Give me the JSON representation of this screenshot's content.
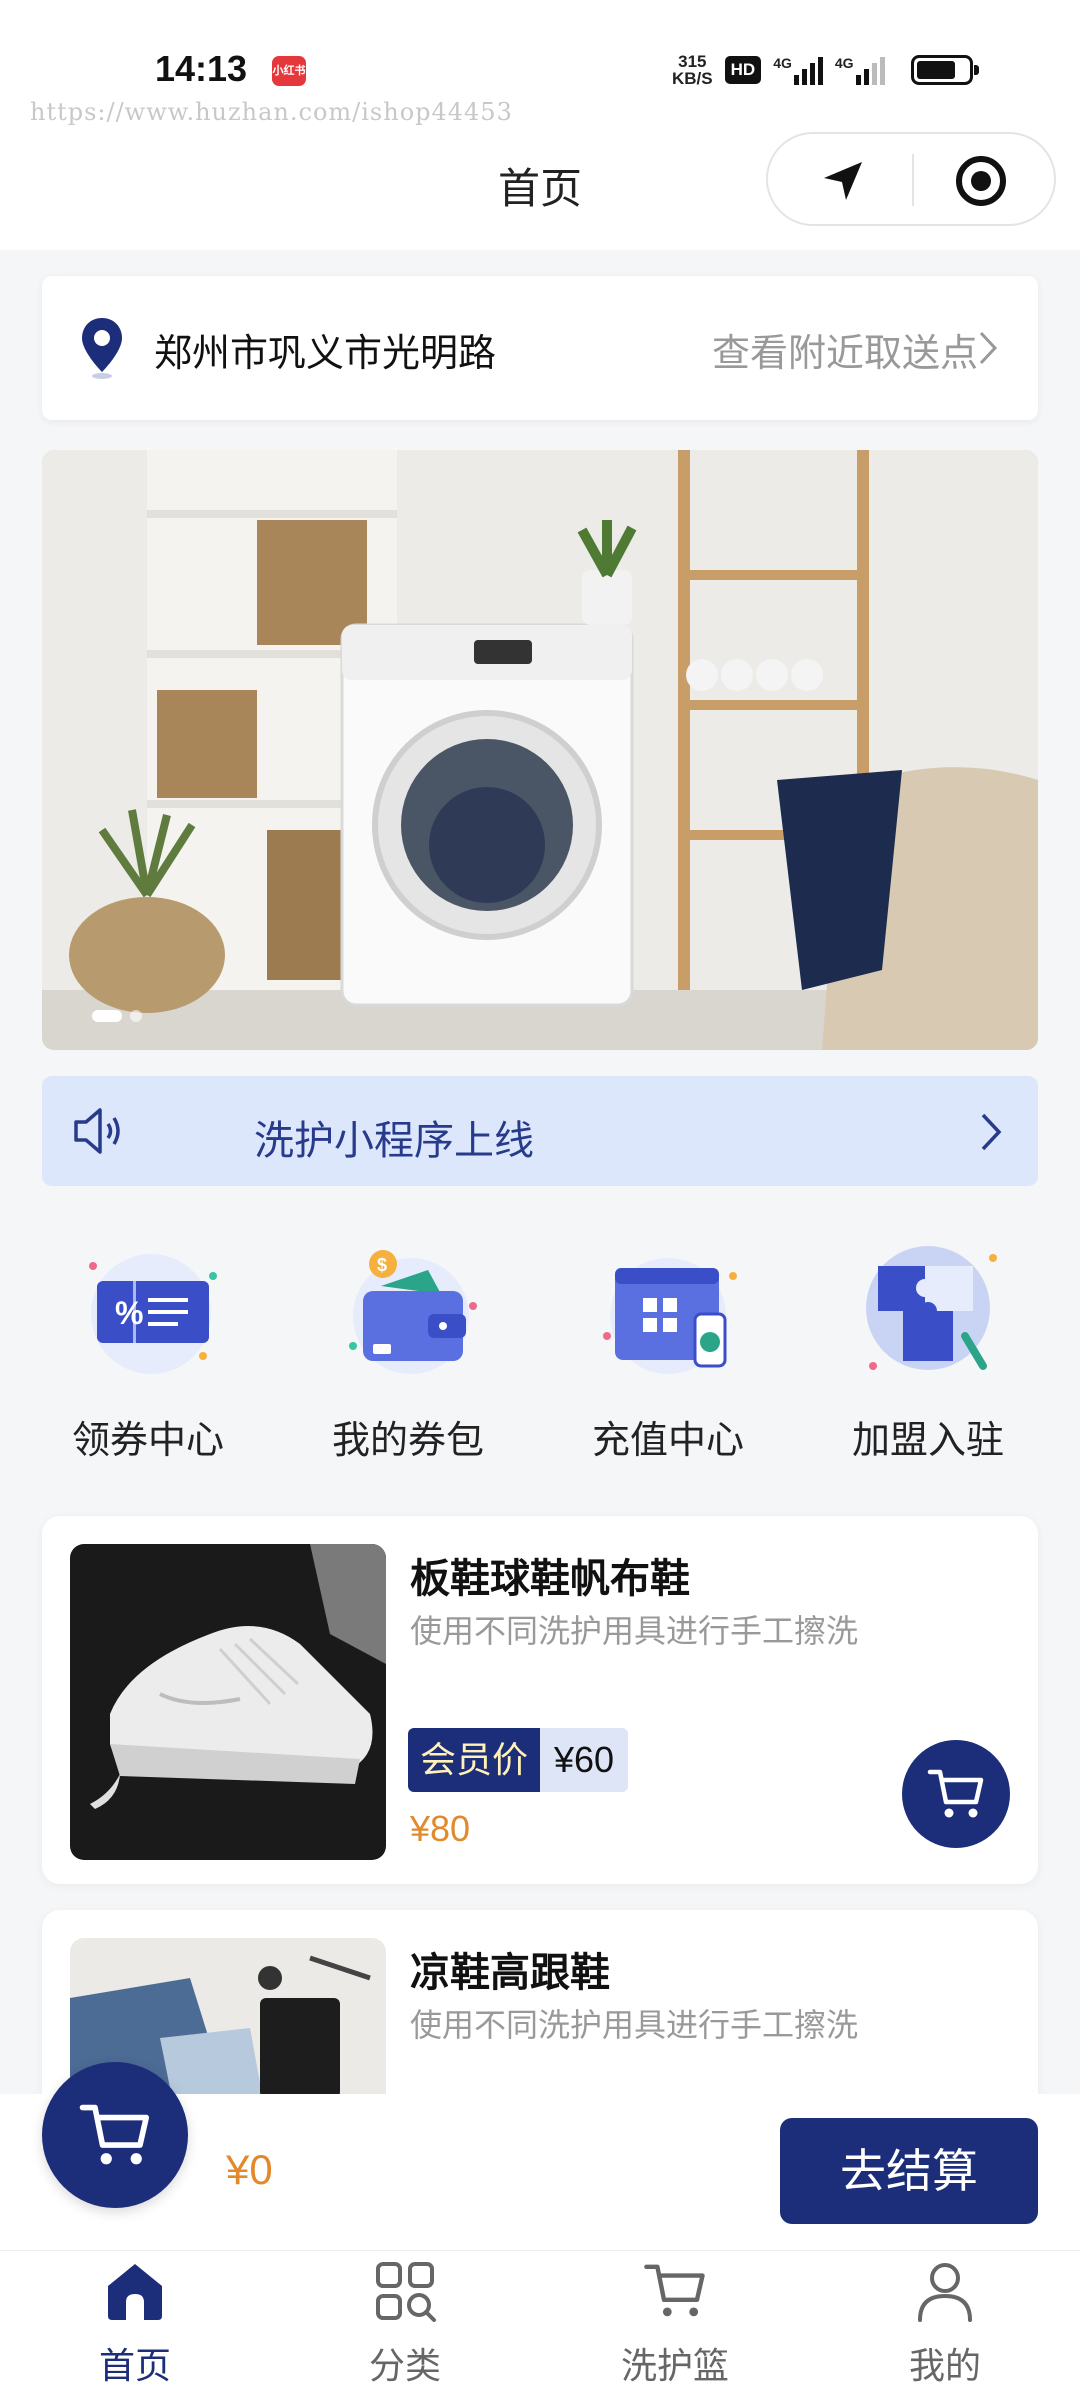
{
  "status_bar": {
    "time": "14:13",
    "notification_badge": "小红书",
    "net_speed_value": "315",
    "net_speed_unit": "KB/S",
    "hd_label": "HD",
    "network_1": "4G",
    "network_2": "4G",
    "battery_level": 0.75
  },
  "watermark": "https://www.huzhan.com/ishop44453",
  "nav": {
    "title": "首页"
  },
  "location": {
    "address": "郑州市巩义市光明路",
    "nearby_link": "查看附近取送点"
  },
  "notice": {
    "text": "洗护小程序上线"
  },
  "shortcuts": [
    {
      "label": "领券中心",
      "icon": "coupon-icon"
    },
    {
      "label": "我的券包",
      "icon": "wallet-icon"
    },
    {
      "label": "充值中心",
      "icon": "recharge-icon"
    },
    {
      "label": "加盟入驻",
      "icon": "puzzle-icon"
    }
  ],
  "products": [
    {
      "title": "板鞋球鞋帆布鞋",
      "desc": "使用不同洗护用具进行手工擦洗",
      "member_tag": "会员价",
      "member_price": "¥60",
      "price": "¥80"
    },
    {
      "title": "凉鞋高跟鞋",
      "desc": "使用不同洗护用具进行手工擦洗"
    }
  ],
  "checkout": {
    "total": "¥0",
    "button": "去结算"
  },
  "tabs": [
    {
      "label": "首页",
      "icon": "home-icon",
      "active": true
    },
    {
      "label": "分类",
      "icon": "category-icon",
      "active": false
    },
    {
      "label": "洗护篮",
      "icon": "basket-icon",
      "active": false
    },
    {
      "label": "我的",
      "icon": "profile-icon",
      "active": false
    }
  ],
  "colors": {
    "brand": "#1c2d7a",
    "price_orange": "#e28a2b",
    "notice_bg": "#dde7fb"
  }
}
